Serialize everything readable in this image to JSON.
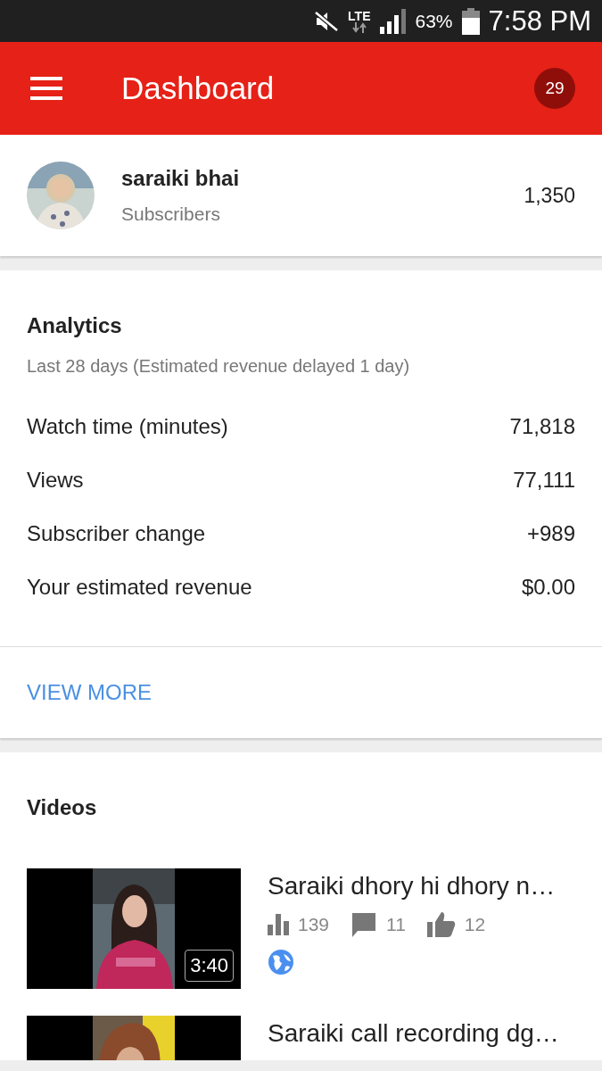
{
  "status_bar": {
    "network": "LTE",
    "battery": "63%",
    "time": "7:58 PM"
  },
  "app_bar": {
    "title": "Dashboard",
    "badge": "29"
  },
  "channel": {
    "name": "saraiki bhai",
    "subtitle": "Subscribers",
    "count": "1,350"
  },
  "analytics": {
    "title": "Analytics",
    "period": "Last 28 days (Estimated revenue delayed 1 day)",
    "metrics": [
      {
        "label": "Watch time (minutes)",
        "value": "71,818"
      },
      {
        "label": "Views",
        "value": "77,111"
      },
      {
        "label": "Subscriber change",
        "value": "+989"
      },
      {
        "label": "Your estimated revenue",
        "value": "$0.00"
      }
    ],
    "action": "VIEW MORE"
  },
  "videos": {
    "title": "Videos",
    "items": [
      {
        "title": "Saraiki dhory hi dhory n…",
        "duration": "3:40",
        "views": "139",
        "comments": "11",
        "likes": "12",
        "public": true
      },
      {
        "title": "Saraiki call recording dg…"
      }
    ]
  }
}
